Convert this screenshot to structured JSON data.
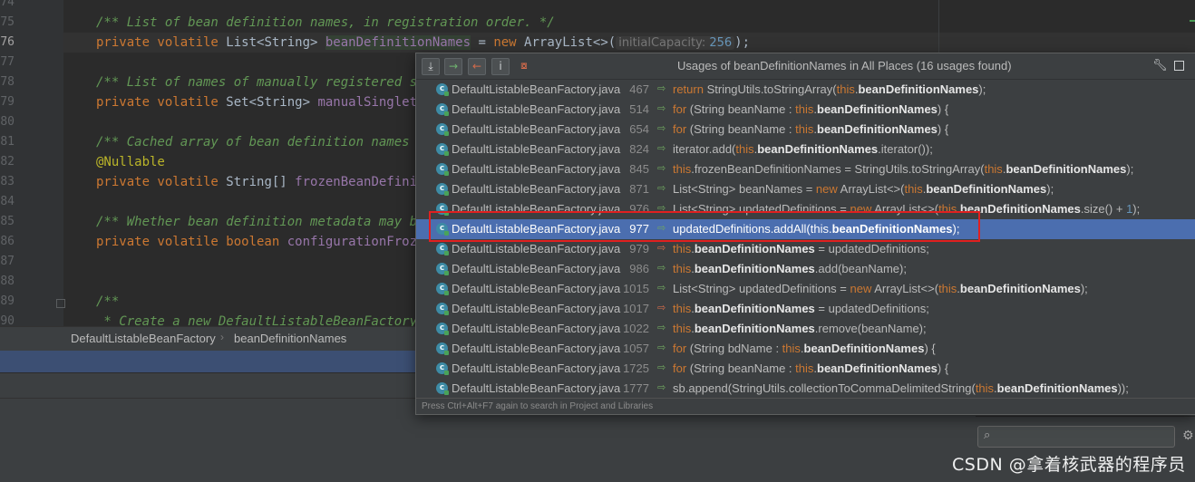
{
  "editor": {
    "line_numbers": [
      "74",
      "75",
      "76",
      "77",
      "78",
      "79",
      "80",
      "81",
      "82",
      "83",
      "84",
      "85",
      "86",
      "87",
      "88",
      "89",
      "90"
    ],
    "lines": [
      {
        "comment": "/** List of bean definition names, in registration order. */"
      },
      {
        "kw1": "private volatile ",
        "type": "List<String> ",
        "field": "beanDefinitionNames",
        "eq": " = ",
        "kw2": "new ",
        "rest": "ArrayList<>(",
        "hint": "initialCapacity:",
        "num": " 256",
        "end": ");"
      },
      {
        "comment": "/** List of names of manually registered sin"
      },
      {
        "kw1": "private volatile ",
        "type": "Set<String> ",
        "field": "manualSingleton"
      },
      {
        "comment": "/** Cached array of bean definition names in"
      },
      {
        "annotation": "@Nullable"
      },
      {
        "kw1": "private volatile ",
        "type": "String[] ",
        "field": "frozenBeanDefiniti"
      },
      {
        "comment": "/** Whether bean definition metadata may be"
      },
      {
        "kw1": "private volatile boolean ",
        "field": "configurationFrozen"
      },
      {
        "comment": "/**"
      },
      {
        "comment": " * Create a new DefaultListableBeanFactory."
      }
    ]
  },
  "breadcrumb": {
    "class_name": "DefaultListableBeanFactory",
    "separator": "›",
    "member": "beanDefinitionNames"
  },
  "popup": {
    "title": "Usages of beanDefinitionNames in All Places (16 usages found)",
    "toolbar": {
      "btn1_icon": "expand-all-icon",
      "btn2_icon": "navigate-next-icon",
      "btn3_icon": "navigate-previous-icon",
      "btn4_icon": "info-icon",
      "btn5_icon": "filter-icon"
    },
    "header_icons": {
      "settings": "wrench-icon",
      "pin": "pin-window-icon"
    },
    "footer": "Press Ctrl+Alt+F7 again to search in Project and Libraries",
    "rows": [
      {
        "file": "DefaultListableBeanFactory.java",
        "line": "467",
        "parts": [
          [
            "k",
            "return "
          ],
          [
            "t",
            "StringUtils.toStringArray("
          ],
          [
            "k",
            "this"
          ],
          [
            "t",
            "."
          ],
          [
            "b",
            "beanDefinitionNames"
          ],
          [
            "t",
            ");"
          ]
        ]
      },
      {
        "file": "DefaultListableBeanFactory.java",
        "line": "514",
        "parts": [
          [
            "k",
            "for "
          ],
          [
            "t",
            "(String beanName : "
          ],
          [
            "k",
            "this"
          ],
          [
            "t",
            "."
          ],
          [
            "b",
            "beanDefinitionNames"
          ],
          [
            "t",
            ") {"
          ]
        ]
      },
      {
        "file": "DefaultListableBeanFactory.java",
        "line": "654",
        "parts": [
          [
            "k",
            "for "
          ],
          [
            "t",
            "(String beanName : "
          ],
          [
            "k",
            "this"
          ],
          [
            "t",
            "."
          ],
          [
            "b",
            "beanDefinitionNames"
          ],
          [
            "t",
            ") {"
          ]
        ]
      },
      {
        "file": "DefaultListableBeanFactory.java",
        "line": "824",
        "parts": [
          [
            "t",
            "iterator.add("
          ],
          [
            "k",
            "this"
          ],
          [
            "t",
            "."
          ],
          [
            "b",
            "beanDefinitionNames"
          ],
          [
            "t",
            ".iterator());"
          ]
        ]
      },
      {
        "file": "DefaultListableBeanFactory.java",
        "line": "845",
        "parts": [
          [
            "k",
            "this"
          ],
          [
            "t",
            ".frozenBeanDefinitionNames = StringUtils.toStringArray("
          ],
          [
            "k",
            "this"
          ],
          [
            "t",
            "."
          ],
          [
            "b",
            "beanDefinitionNames"
          ],
          [
            "t",
            ");"
          ]
        ]
      },
      {
        "file": "DefaultListableBeanFactory.java",
        "line": "871",
        "parts": [
          [
            "t",
            "List<String> beanNames = "
          ],
          [
            "k",
            "new "
          ],
          [
            "t",
            "ArrayList<>("
          ],
          [
            "k",
            "this"
          ],
          [
            "t",
            "."
          ],
          [
            "b",
            "beanDefinitionNames"
          ],
          [
            "t",
            ");"
          ]
        ]
      },
      {
        "file": "DefaultListableBeanFactory.java",
        "line": "976",
        "parts": [
          [
            "t",
            "List<String> updatedDefinitions = "
          ],
          [
            "k",
            "new "
          ],
          [
            "t",
            "ArrayList<>("
          ],
          [
            "k",
            "this"
          ],
          [
            "t",
            "."
          ],
          [
            "b",
            "beanDefinitionNames"
          ],
          [
            "t",
            ".size() + "
          ],
          [
            "n",
            "1"
          ],
          [
            "t",
            ");"
          ]
        ]
      },
      {
        "file": "DefaultListableBeanFactory.java",
        "line": "977",
        "selected": true,
        "parts": [
          [
            "t",
            "updatedDefinitions.addAll(this."
          ],
          [
            "b",
            "beanDefinitionNames"
          ],
          [
            "t",
            ");"
          ]
        ]
      },
      {
        "file": "DefaultListableBeanFactory.java",
        "line": "979",
        "write": true,
        "parts": [
          [
            "k",
            "this"
          ],
          [
            "t",
            "."
          ],
          [
            "b",
            "beanDefinitionNames"
          ],
          [
            "t",
            " = updatedDefinitions;"
          ]
        ]
      },
      {
        "file": "DefaultListableBeanFactory.java",
        "line": "986",
        "parts": [
          [
            "k",
            "this"
          ],
          [
            "t",
            "."
          ],
          [
            "b",
            "beanDefinitionNames"
          ],
          [
            "t",
            ".add(beanName);"
          ]
        ]
      },
      {
        "file": "DefaultListableBeanFactory.java",
        "line": "1015",
        "parts": [
          [
            "t",
            "List<String> updatedDefinitions = "
          ],
          [
            "k",
            "new "
          ],
          [
            "t",
            "ArrayList<>("
          ],
          [
            "k",
            "this"
          ],
          [
            "t",
            "."
          ],
          [
            "b",
            "beanDefinitionNames"
          ],
          [
            "t",
            ");"
          ]
        ]
      },
      {
        "file": "DefaultListableBeanFactory.java",
        "line": "1017",
        "write": true,
        "parts": [
          [
            "k",
            "this"
          ],
          [
            "t",
            "."
          ],
          [
            "b",
            "beanDefinitionNames"
          ],
          [
            "t",
            " = updatedDefinitions;"
          ]
        ]
      },
      {
        "file": "DefaultListableBeanFactory.java",
        "line": "1022",
        "parts": [
          [
            "k",
            "this"
          ],
          [
            "t",
            "."
          ],
          [
            "b",
            "beanDefinitionNames"
          ],
          [
            "t",
            ".remove(beanName);"
          ]
        ]
      },
      {
        "file": "DefaultListableBeanFactory.java",
        "line": "1057",
        "parts": [
          [
            "k",
            "for "
          ],
          [
            "t",
            "(String bdName : "
          ],
          [
            "k",
            "this"
          ],
          [
            "t",
            "."
          ],
          [
            "b",
            "beanDefinitionNames"
          ],
          [
            "t",
            ") {"
          ]
        ]
      },
      {
        "file": "DefaultListableBeanFactory.java",
        "line": "1725",
        "parts": [
          [
            "k",
            "for "
          ],
          [
            "t",
            "(String beanName : "
          ],
          [
            "k",
            "this"
          ],
          [
            "t",
            "."
          ],
          [
            "b",
            "beanDefinitionNames"
          ],
          [
            "t",
            ") {"
          ]
        ]
      },
      {
        "file": "DefaultListableBeanFactory.java",
        "line": "1777",
        "parts": [
          [
            "t",
            "sb.append(StringUtils.collectionToCommaDelimitedString("
          ],
          [
            "k",
            "this"
          ],
          [
            "t",
            "."
          ],
          [
            "b",
            "beanDefinitionNames"
          ],
          [
            "t",
            "));"
          ]
        ]
      }
    ]
  },
  "watermark": "CSDN @拿着核武器的程序员",
  "colors": {
    "selection": "#4b6eaf",
    "highlight_box": "#e02020",
    "keyword": "#cc7832",
    "comment": "#629755",
    "field": "#9876aa"
  }
}
